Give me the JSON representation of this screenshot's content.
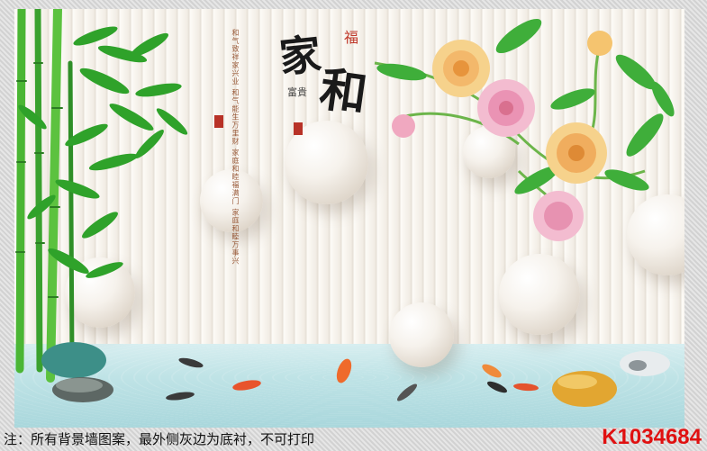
{
  "artwork": {
    "calligraphy_char_1": "家",
    "calligraphy_char_2": "和",
    "small_char": "福",
    "fugui": "富貴",
    "poem_lines": [
      "和气致祥家兴业",
      "和气能生万里财",
      "家庭和睦福满门",
      "家庭和睦万事兴"
    ]
  },
  "footer": {
    "note": "注：所有背景墙图案，最外侧灰边为底衬，不可打印",
    "code": "K1034684"
  },
  "colors": {
    "code_red": "#e01010",
    "bamboo_green": "#3aa12e",
    "water": "#bfe3e6"
  }
}
